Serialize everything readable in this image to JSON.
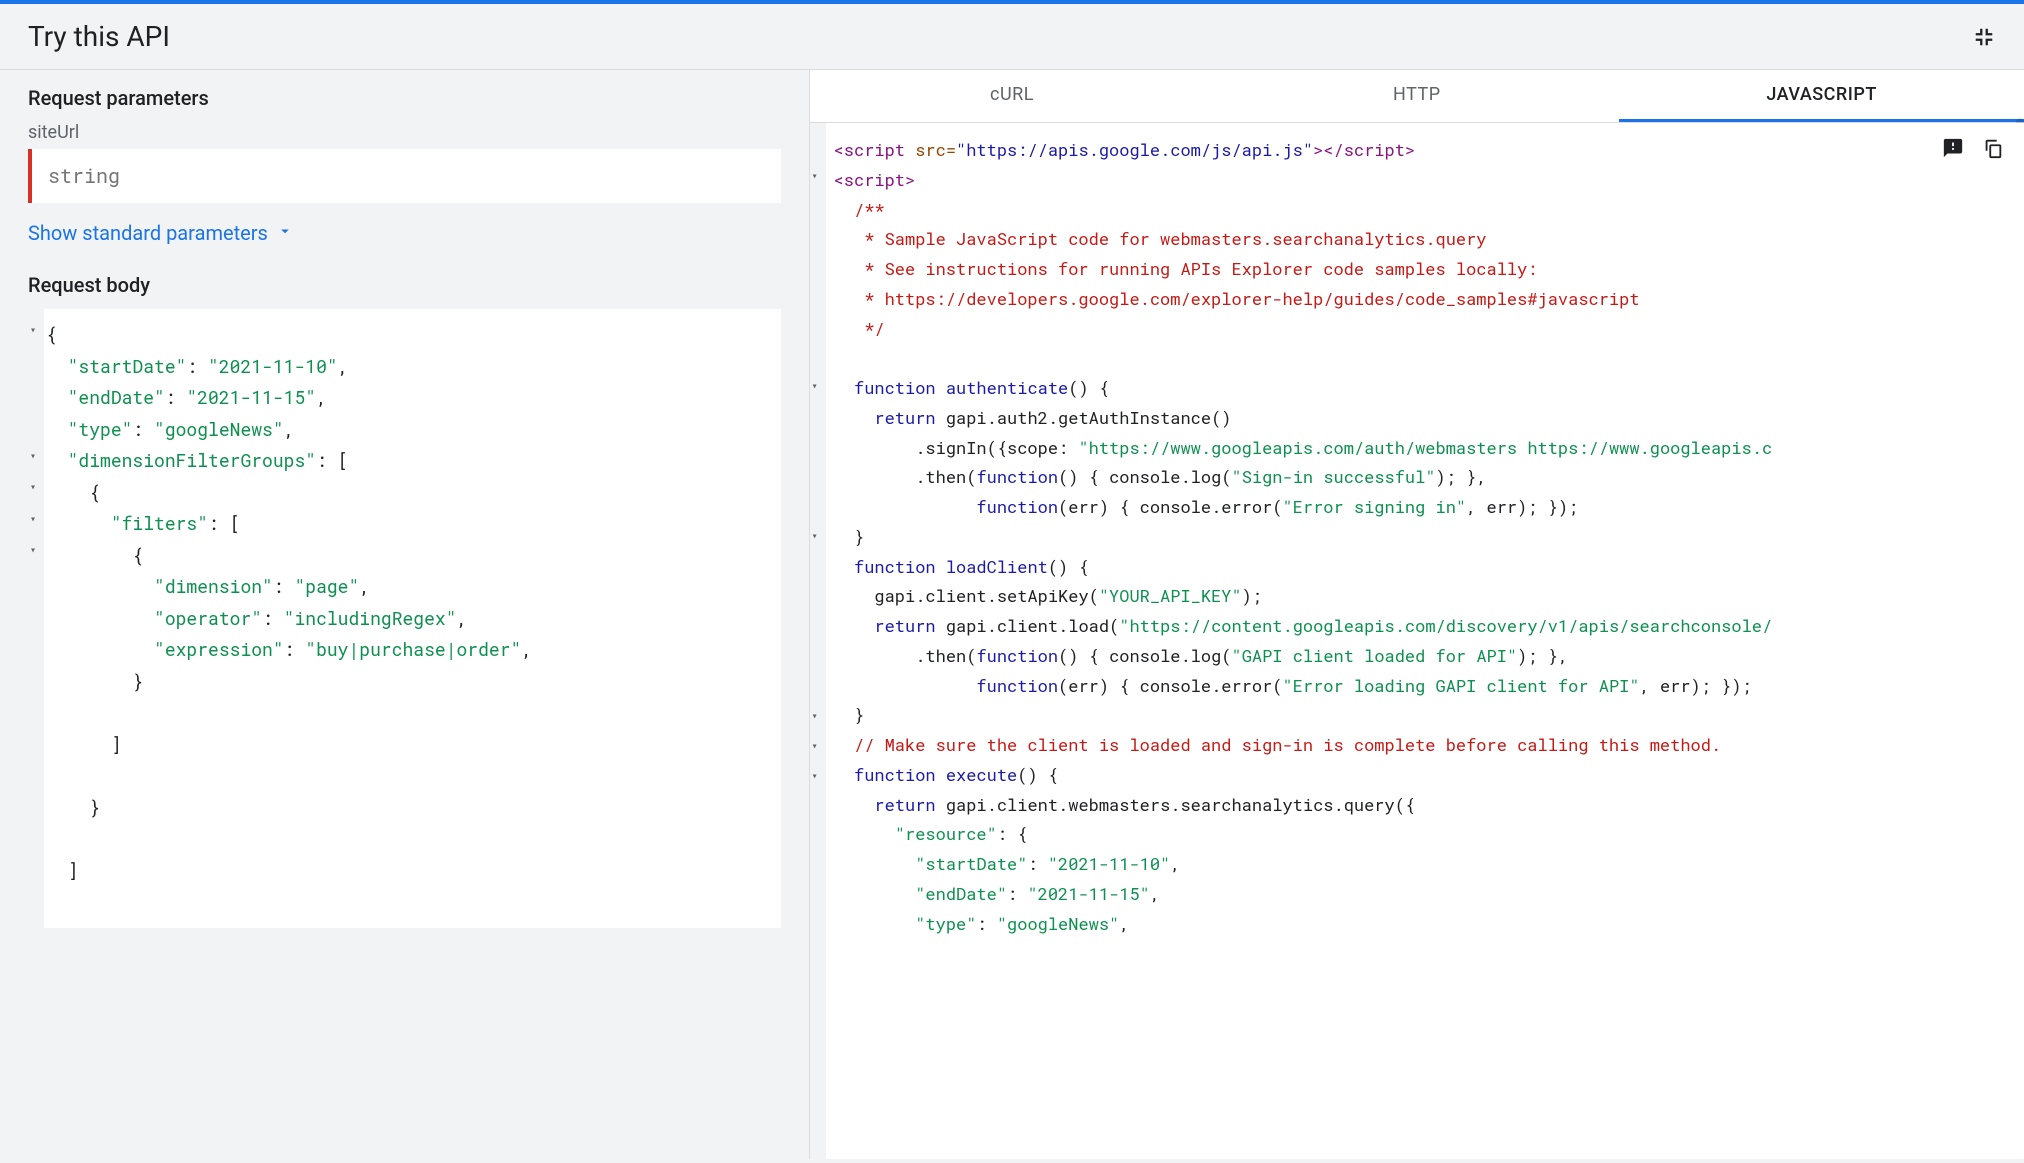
{
  "header": {
    "title": "Try this API"
  },
  "left": {
    "request_parameters_title": "Request parameters",
    "param_name": "siteUrl",
    "param_placeholder": "string",
    "expand_link": "Show standard parameters",
    "request_body_title": "Request body",
    "json_body": {
      "startDate": "2021-11-10",
      "endDate": "2021-11-15",
      "type": "googleNews",
      "dimensionFilterGroups": [
        {
          "filters": [
            {
              "dimension": "page",
              "operator": "includingRegex",
              "expression": "buy|purchase|order"
            }
          ]
        }
      ]
    }
  },
  "tabs": {
    "curl": "cURL",
    "http": "HTTP",
    "javascript": "JAVASCRIPT"
  },
  "code": {
    "script_src": "https://apis.google.com/js/api.js",
    "comment_lines": [
      "  /**",
      "   * Sample JavaScript code for webmasters.searchanalytics.query",
      "   * See instructions for running APIs Explorer code samples locally:",
      "   * https://developers.google.com/explorer-help/guides/code_samples#javascript",
      "   */"
    ],
    "authenticate_name": "authenticate",
    "loadClient_name": "loadClient",
    "execute_name": "execute",
    "signin_scope": "\"https://www.googleapis.com/auth/webmasters https://www.googleapis.c",
    "signin_success": "\"Sign-in successful\"",
    "signin_error": "\"Error signing in\"",
    "api_key": "\"YOUR_API_KEY\"",
    "client_load_url": "\"https://content.googleapis.com/discovery/v1/apis/searchconsole/",
    "client_loaded_msg": "\"GAPI client loaded for API\"",
    "client_error_msg": "\"Error loading GAPI client for API\"",
    "make_sure_comment": "  // Make sure the client is loaded and sign-in is complete before calling this method.",
    "resource_key": "\"resource\"",
    "startDate_key": "\"startDate\"",
    "startDate_val": "\"2021-11-10\"",
    "endDate_key": "\"endDate\"",
    "endDate_val": "\"2021-11-15\"",
    "type_key": "\"type\"",
    "type_val": "\"googleNews\""
  }
}
